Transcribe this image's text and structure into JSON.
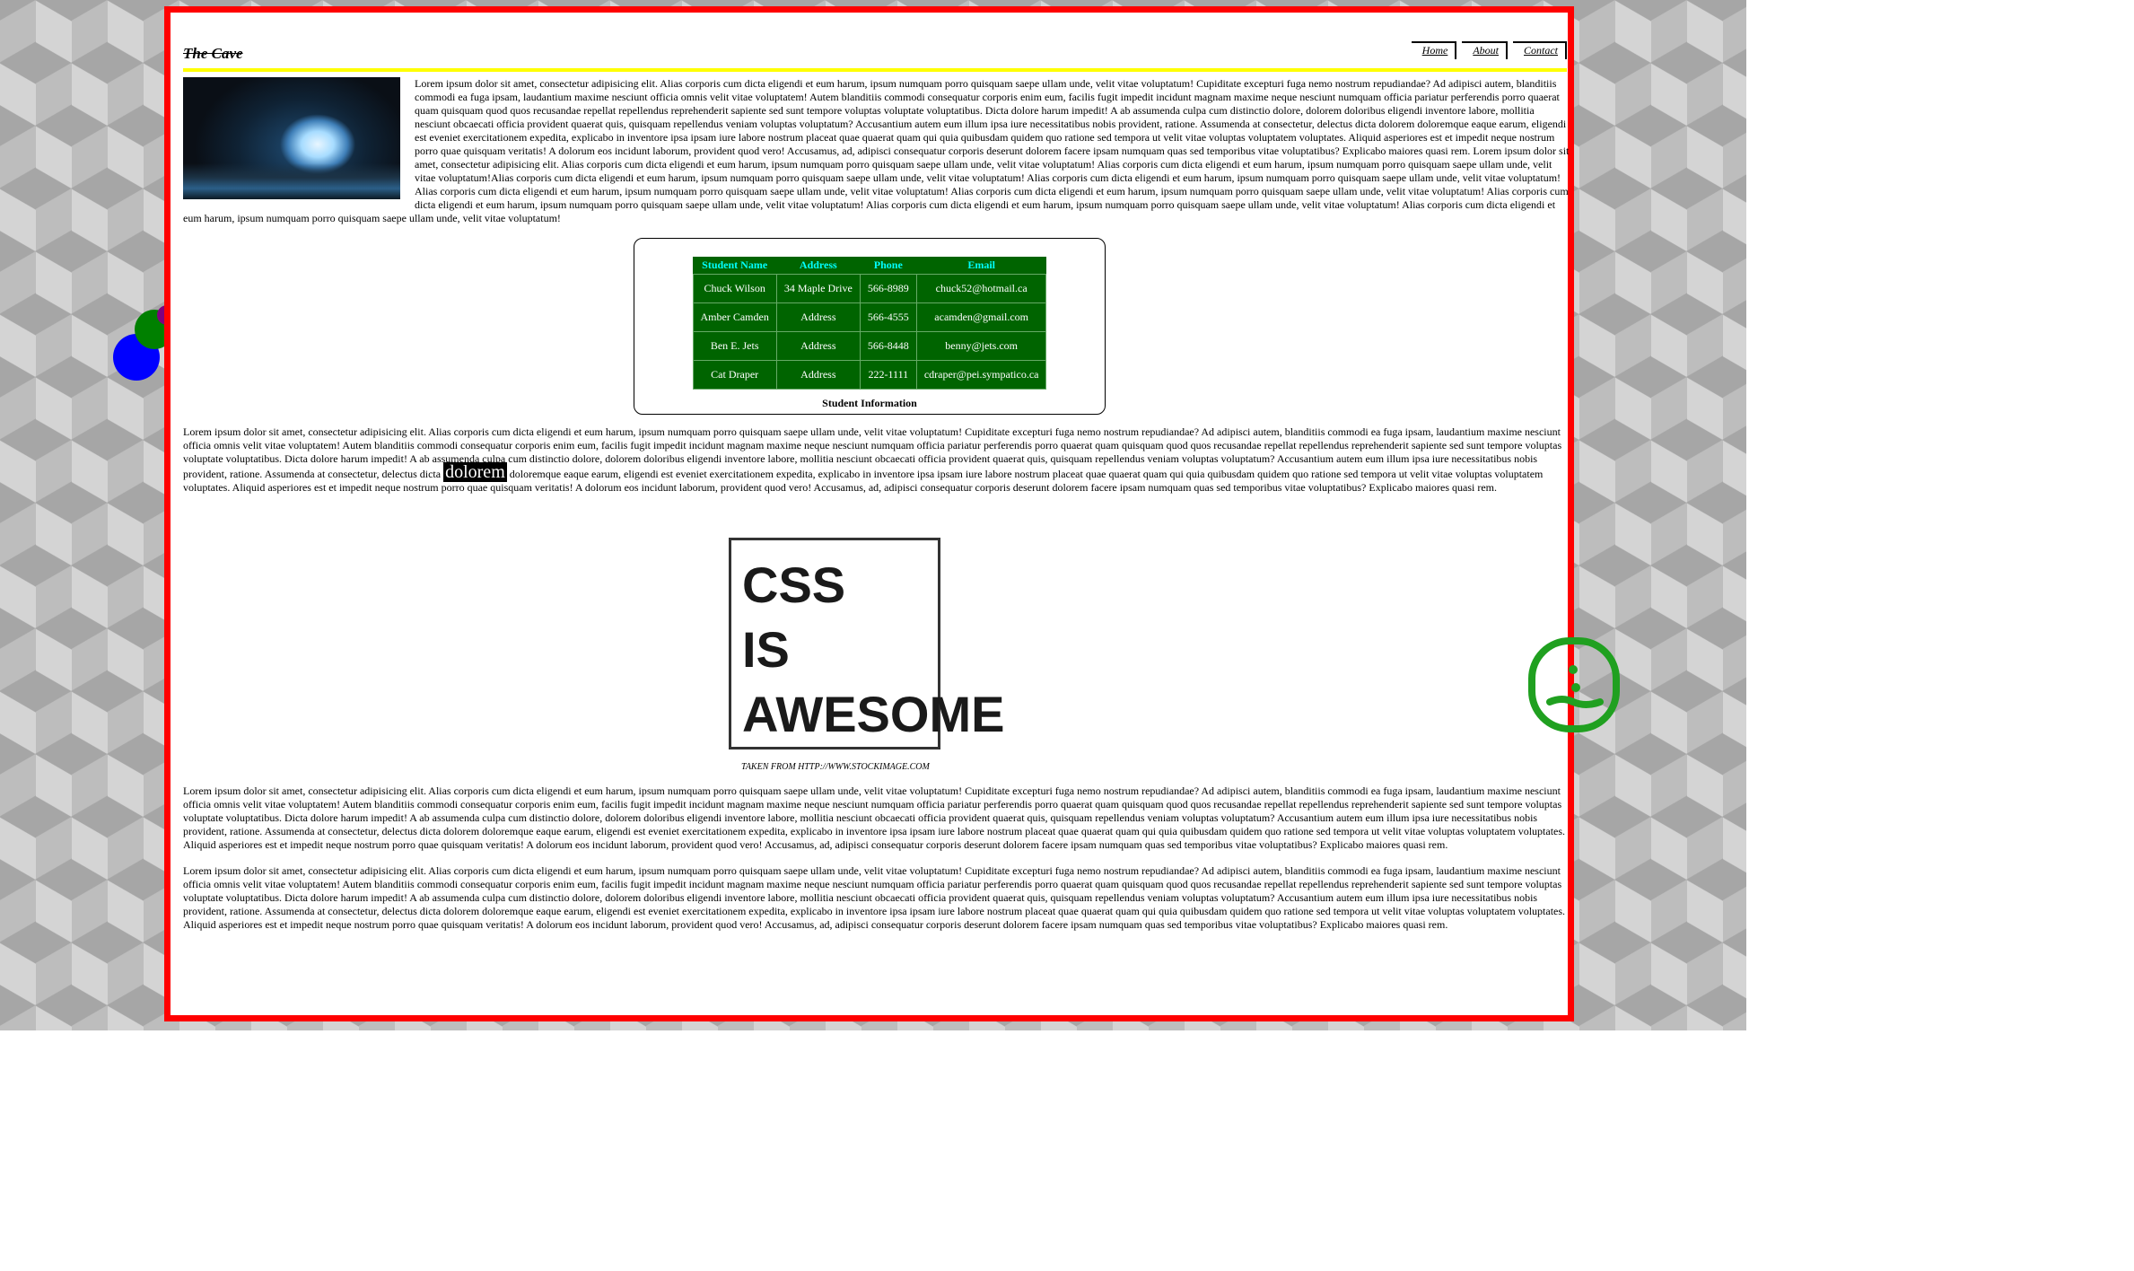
{
  "header": {
    "site_title": "The Cave",
    "nav": [
      "Home",
      "About",
      "Contact"
    ]
  },
  "intro_text": "Lorem ipsum dolor sit amet, consectetur adipisicing elit. Alias corporis cum dicta eligendi et eum harum, ipsum numquam porro quisquam saepe ullam unde, velit vitae voluptatum! Cupiditate excepturi fuga nemo nostrum repudiandae? Ad adipisci autem, blanditiis commodi ea fuga ipsam, laudantium maxime nesciunt officia omnis velit vitae voluptatem! Autem blanditiis commodi consequatur corporis enim eum, facilis fugit impedit incidunt magnam maxime neque nesciunt numquam officia pariatur perferendis porro quaerat quam quisquam quod quos recusandae repellat repellendus reprehenderit sapiente sed sunt tempore voluptas voluptate voluptatibus. Dicta dolore harum impedit! A ab assumenda culpa cum distinctio dolore, dolorem doloribus eligendi inventore labore, mollitia nesciunt obcaecati officia provident quaerat quis, quisquam repellendus veniam voluptas voluptatum? Accusantium autem eum illum ipsa iure necessitatibus nobis provident, ratione. Assumenda at consectetur, delectus dicta dolorem doloremque eaque earum, eligendi est eveniet exercitationem expedita, explicabo in inventore ipsa ipsam iure labore nostrum placeat quae quaerat quam qui quia quibusdam quidem quo ratione sed tempora ut velit vitae voluptas voluptatem voluptates. Aliquid asperiores est et impedit neque nostrum porro quae quisquam veritatis! A dolorum eos incidunt laborum, provident quod vero! Accusamus, ad, adipisci consequatur corporis deserunt dolorem facere ipsam numquam quas sed temporibus vitae voluptatibus? Explicabo maiores quasi rem. Lorem ipsum dolor sit amet, consectetur adipisicing elit. Alias corporis cum dicta eligendi et eum harum, ipsum numquam porro quisquam saepe ullam unde, velit vitae voluptatum! Alias corporis cum dicta eligendi et eum harum, ipsum numquam porro quisquam saepe ullam unde, velit vitae voluptatum!Alias corporis cum dicta eligendi et eum harum, ipsum numquam porro quisquam saepe ullam unde, velit vitae voluptatum! Alias corporis cum dicta eligendi et eum harum, ipsum numquam porro quisquam saepe ullam unde, velit vitae voluptatum! Alias corporis cum dicta eligendi et eum harum, ipsum numquam porro quisquam saepe ullam unde, velit vitae voluptatum! Alias corporis cum dicta eligendi et eum harum, ipsum numquam porro quisquam saepe ullam unde, velit vitae voluptatum! Alias corporis cum dicta eligendi et eum harum, ipsum numquam porro quisquam saepe ullam unde, velit vitae voluptatum! Alias corporis cum dicta eligendi et eum harum, ipsum numquam porro quisquam saepe ullam unde, velit vitae voluptatum! Alias corporis cum dicta eligendi et eum harum, ipsum numquam porro quisquam saepe ullam unde, velit vitae voluptatum!",
  "table": {
    "headers": [
      "Student Name",
      "Address",
      "Phone",
      "Email"
    ],
    "rows": [
      [
        "Chuck Wilson",
        "34 Maple Drive",
        "566-8989",
        "chuck52@hotmail.ca"
      ],
      [
        "Amber Camden",
        "Address",
        "566-4555",
        "acamden@gmail.com"
      ],
      [
        "Ben E. Jets",
        "Address",
        "566-8448",
        "benny@jets.com"
      ],
      [
        "Cat Draper",
        "Address",
        "222-1111",
        "cdraper@pei.sympatico.ca"
      ]
    ],
    "caption": "Student Information"
  },
  "para2_before": "Lorem ipsum dolor sit amet, consectetur adipisicing elit. Alias corporis cum dicta eligendi et eum harum, ipsum numquam porro quisquam saepe ullam unde, velit vitae voluptatum! Cupiditate excepturi fuga nemo nostrum repudiandae? Ad adipisci autem, blanditiis commodi ea fuga ipsam, laudantium maxime nesciunt officia omnis velit vitae voluptatem! Autem blanditiis commodi consequatur corporis enim eum, facilis fugit impedit incidunt magnam maxime neque nesciunt numquam officia pariatur perferendis porro quaerat quam quisquam quod quos recusandae repellat repellendus reprehenderit sapiente sed sunt tempore voluptas voluptate voluptatibus. Dicta dolore harum impedit! A ab assumenda culpa cum distinctio dolore, dolorem doloribus eligendi inventore labore, mollitia nesciunt obcaecati officia provident quaerat quis, quisquam repellendus veniam voluptas voluptatum? Accusantium autem eum illum ipsa iure necessitatibus nobis provident, ratione. Assumenda at consectetur, delectus dicta",
  "para2_highlight": "dolorem",
  "para2_after": "doloremque eaque earum, eligendi est eveniet exercitationem expedita, explicabo in inventore ipsa ipsam iure labore nostrum placeat quae quaerat quam qui quia quibusdam quidem quo ratione sed tempora ut velit vitae voluptas voluptatem voluptates. Aliquid asperiores est et impedit neque nostrum porro quae quisquam veritatis! A dolorum eos incidunt laborum, provident quod vero! Accusamus, ad, adipisci consequatur corporis deserunt dolorem facere ipsam numquam quas sed temporibus vitae voluptatibus? Explicabo maiores quasi rem.",
  "figure": {
    "line1": "CSS",
    "line2": "IS",
    "line3": "AWESOME",
    "credit": "TAKEN FROM HTTP://WWW.STOCKIMAGE.COM"
  },
  "para3": "Lorem ipsum dolor sit amet, consectetur adipisicing elit. Alias corporis cum dicta eligendi et eum harum, ipsum numquam porro quisquam saepe ullam unde, velit vitae voluptatum! Cupiditate excepturi fuga nemo nostrum repudiandae? Ad adipisci autem, blanditiis commodi ea fuga ipsam, laudantium maxime nesciunt officia omnis velit vitae voluptatem! Autem blanditiis commodi consequatur corporis enim eum, facilis fugit impedit incidunt magnam maxime neque nesciunt numquam officia pariatur perferendis porro quaerat quam quisquam quod quos recusandae repellat repellendus reprehenderit sapiente sed sunt tempore voluptas voluptate voluptatibus. Dicta dolore harum impedit! A ab assumenda culpa cum distinctio dolore, dolorem doloribus eligendi inventore labore, mollitia nesciunt obcaecati officia provident quaerat quis, quisquam repellendus veniam voluptas voluptatum? Accusantium autem eum illum ipsa iure necessitatibus nobis provident, ratione. Assumenda at consectetur, delectus dicta dolorem doloremque eaque earum, eligendi est eveniet exercitationem expedita, explicabo in inventore ipsa ipsam iure labore nostrum placeat quae quaerat quam qui quia quibusdam quidem quo ratione sed tempora ut velit vitae voluptas voluptatem voluptates. Aliquid asperiores est et impedit neque nostrum porro quae quisquam veritatis! A dolorum eos incidunt laborum, provident quod vero! Accusamus, ad, adipisci consequatur corporis deserunt dolorem facere ipsam numquam quas sed temporibus vitae voluptatibus? Explicabo maiores quasi rem.",
  "para4": "Lorem ipsum dolor sit amet, consectetur adipisicing elit. Alias corporis cum dicta eligendi et eum harum, ipsum numquam porro quisquam saepe ullam unde, velit vitae voluptatum! Cupiditate excepturi fuga nemo nostrum repudiandae? Ad adipisci autem, blanditiis commodi ea fuga ipsam, laudantium maxime nesciunt officia omnis velit vitae voluptatem! Autem blanditiis commodi consequatur corporis enim eum, facilis fugit impedit incidunt magnam maxime neque nesciunt numquam officia pariatur perferendis porro quaerat quam quisquam quod quos recusandae repellat repellendus reprehenderit sapiente sed sunt tempore voluptas voluptate voluptatibus. Dicta dolore harum impedit! A ab assumenda culpa cum distinctio dolore, dolorem doloribus eligendi inventore labore, mollitia nesciunt obcaecati officia provident quaerat quis, quisquam repellendus veniam voluptas voluptatum? Accusantium autem eum illum ipsa iure necessitatibus nobis provident, ratione. Assumenda at consectetur, delectus dicta dolorem doloremque eaque earum, eligendi est eveniet exercitationem expedita, explicabo in inventore ipsa ipsam iure labore nostrum placeat quae quaerat quam qui quia quibusdam quidem quo ratione sed tempora ut velit vitae voluptas voluptatem voluptates. Aliquid asperiores est et impedit neque nostrum porro quae quisquam veritatis! A dolorum eos incidunt laborum, provident quod vero! Accusamus, ad, adipisci consequatur corporis deserunt dolorem facere ipsam numquam quas sed temporibus vitae voluptatibus? Explicabo maiores quasi rem.",
  "colors": {
    "page_border": "#ff0000",
    "header_rule": "#ffff00",
    "table_bg": "#006400",
    "table_header_text": "#00ffff",
    "circle_blue": "#0000ff",
    "circle_green": "#008000",
    "circle_purple": "#800080",
    "smiley": "#20a020"
  },
  "icons": [
    "cave-photo",
    "decorative-circles",
    "smiley-face-icon"
  ]
}
